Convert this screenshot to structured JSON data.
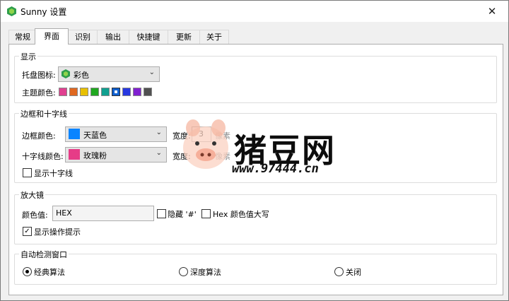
{
  "window": {
    "title": "Sunny 设置",
    "close_glyph": "✕",
    "app_icon": "sunny-logo-icon"
  },
  "tabs": [
    {
      "label": "常规",
      "active": false
    },
    {
      "label": "界面",
      "active": true
    },
    {
      "label": "识别",
      "active": false
    },
    {
      "label": "输出",
      "active": false
    },
    {
      "label": "快捷键",
      "active": false
    },
    {
      "label": "更新",
      "active": false
    },
    {
      "label": "关于",
      "active": false
    }
  ],
  "display": {
    "title": "显示",
    "tray_icon_label": "托盘图标:",
    "tray_icon_value": "彩色",
    "theme_color_label": "主题颜色:",
    "theme_colors": [
      "#e04090",
      "#e06820",
      "#e8c000",
      "#20a820",
      "#10a090",
      "#1060d0",
      "#2838e0",
      "#8020d0",
      "#505050"
    ],
    "selected_theme_index": 5
  },
  "border": {
    "title": "边框和十字线",
    "border_color_label": "边框颜色:",
    "border_color_value": "天蓝色",
    "border_color_hex": "#0a84ff",
    "width_label": "宽度:",
    "width_value": "3",
    "unit_label": "像素",
    "cross_color_label": "十字线颜色:",
    "cross_color_value": "玫瑰粉",
    "cross_color_hex": "#e63c87",
    "cross_width_label": "宽度:",
    "cross_unit_label": "像素",
    "show_cross_label": "显示十字线",
    "show_cross_checked": false
  },
  "magnifier": {
    "title": "放大镜",
    "color_value_label": "颜色值:",
    "color_value": "HEX",
    "hide_hash_label": "隐藏 '#'",
    "hide_hash_checked": false,
    "hex_upper_label": "Hex 颜色值大写",
    "hex_upper_checked": false,
    "show_tips_label": "显示操作提示",
    "show_tips_checked": true,
    "check_glyph": "✓"
  },
  "auto_detect": {
    "title": "自动检测窗口",
    "options": [
      {
        "label": "经典算法",
        "selected": true
      },
      {
        "label": "深度算法",
        "selected": false
      },
      {
        "label": "关闭",
        "selected": false
      }
    ]
  },
  "watermark": {
    "title": "猪豆网",
    "url": "www.97444.cn"
  }
}
